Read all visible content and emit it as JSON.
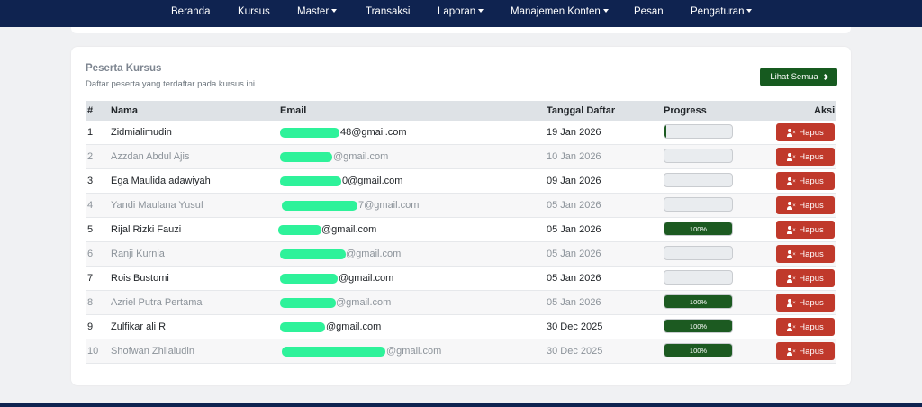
{
  "nav": {
    "items": [
      {
        "label": "Beranda",
        "dropdown": false
      },
      {
        "label": "Kursus",
        "dropdown": false
      },
      {
        "label": "Master",
        "dropdown": true
      },
      {
        "label": "Transaksi",
        "dropdown": false
      },
      {
        "label": "Laporan",
        "dropdown": true
      },
      {
        "label": "Manajemen Konten",
        "dropdown": true
      },
      {
        "label": "Pesan",
        "dropdown": false
      },
      {
        "label": "Pengaturan",
        "dropdown": true
      }
    ]
  },
  "card": {
    "title": "Peserta Kursus",
    "subtitle": "Daftar peserta yang terdaftar pada kursus ini",
    "view_all_label": "Lihat Semua"
  },
  "table": {
    "headers": {
      "num": "#",
      "name": "Nama",
      "email": "Email",
      "date": "Tanggal Daftar",
      "progress": "Progress",
      "action": "Aksi"
    },
    "delete_label": "Hapus",
    "rows": [
      {
        "num": "1",
        "name": "Zidmialimudin",
        "email_visible": "48@gmail.com",
        "date": "19 Jan 2026",
        "progress": 3,
        "progress_label": ""
      },
      {
        "num": "2",
        "name": "Azzdan Abdul Ajis",
        "email_visible": "@gmail.com",
        "date": "10 Jan 2026",
        "progress": 0,
        "progress_label": ""
      },
      {
        "num": "3",
        "name": "Ega Maulida adawiyah",
        "email_visible": "0@gmail.com",
        "date": "09 Jan 2026",
        "progress": 0,
        "progress_label": ""
      },
      {
        "num": "4",
        "name": "Yandi Maulana Yusuf",
        "email_visible": "7@gmail.com",
        "date": "05 Jan 2026",
        "progress": 0,
        "progress_label": ""
      },
      {
        "num": "5",
        "name": "Rijal Rizki Fauzi",
        "email_visible": "@gmail.com",
        "date": "05 Jan 2026",
        "progress": 100,
        "progress_label": "100%"
      },
      {
        "num": "6",
        "name": "Ranji Kurnia",
        "email_visible": "@gmail.com",
        "date": "05 Jan 2026",
        "progress": 0,
        "progress_label": ""
      },
      {
        "num": "7",
        "name": "Rois Bustomi",
        "email_visible": "@gmail.com",
        "date": "05 Jan 2026",
        "progress": 0,
        "progress_label": ""
      },
      {
        "num": "8",
        "name": "Azriel Putra Pertama",
        "email_visible": "@gmail.com",
        "date": "05 Jan 2026",
        "progress": 100,
        "progress_label": "100%"
      },
      {
        "num": "9",
        "name": "Zulfikar ali R",
        "email_visible": "@gmail.com",
        "date": "30 Dec 2025",
        "progress": 100,
        "progress_label": "100%"
      },
      {
        "num": "10",
        "name": "Shofwan Zhilaludin",
        "email_visible": "@gmail.com",
        "date": "30 Dec 2025",
        "progress": 100,
        "progress_label": "100%"
      }
    ]
  },
  "colors": {
    "navbar": "#0f2350",
    "primary_button": "#165a1f",
    "progress_fill": "#1c5a21",
    "delete_button": "#c0392b",
    "redaction": "#2ef29a"
  }
}
